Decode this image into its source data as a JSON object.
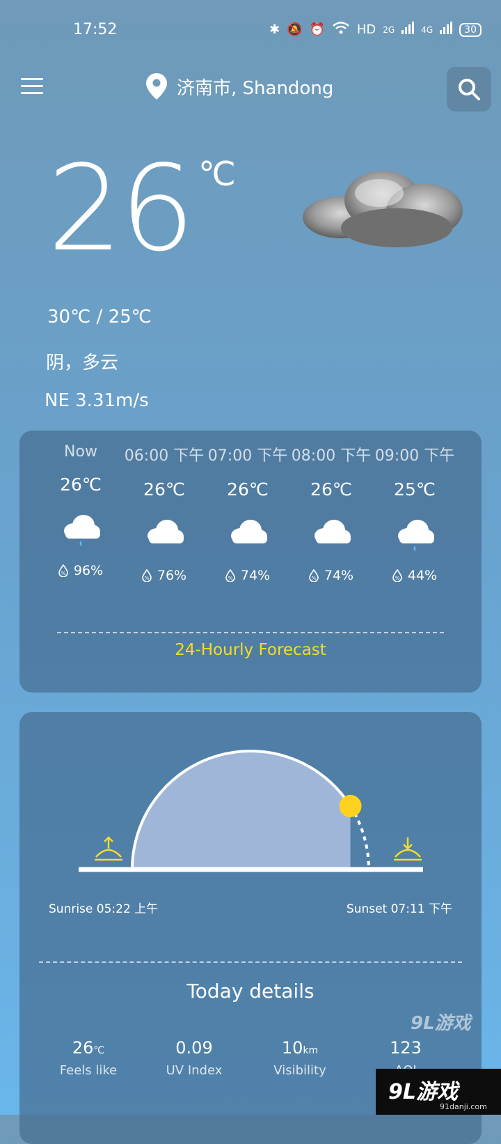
{
  "status_bar": {
    "time": "17:52",
    "network": "HD",
    "signal_2g": "2G",
    "signal_4g": "4G",
    "battery": "30"
  },
  "header": {
    "location": "济南市, Shandong"
  },
  "current": {
    "temperature": "26",
    "unit": "℃",
    "hi_lo": "30℃ / 25℃",
    "condition": "阴，多云",
    "wind": "NE  3.31m/s",
    "icon": "cloud-icon"
  },
  "hourly": [
    {
      "time": "Now",
      "temp": "26℃",
      "icon": "rain-cloud-icon",
      "humidity": "96%"
    },
    {
      "time": "06:00 下午",
      "temp": "26℃",
      "icon": "cloud-icon",
      "humidity": "76%"
    },
    {
      "time": "07:00 下午",
      "temp": "26℃",
      "icon": "cloud-icon",
      "humidity": "74%"
    },
    {
      "time": "08:00 下午",
      "temp": "26℃",
      "icon": "cloud-icon",
      "humidity": "74%"
    },
    {
      "time": "09:00 下午",
      "temp": "25℃",
      "icon": "rain-cloud-icon",
      "humidity": "44%"
    }
  ],
  "forecast_link": "24-Hourly Forecast",
  "sun": {
    "sunrise": "Sunrise 05:22 上午",
    "sunset": "Sunset 07:11 下午",
    "day_progress": 0.82
  },
  "details": {
    "title": "Today details",
    "items": [
      {
        "value": "26",
        "unit": "℃",
        "label": "Feels like"
      },
      {
        "value": "0.09",
        "unit": "",
        "label": "UV Index"
      },
      {
        "value": "10",
        "unit": "km",
        "label": "Visibility"
      },
      {
        "value": "123",
        "unit": "",
        "label": "AQI"
      }
    ]
  },
  "watermark": {
    "small": "9L游戏",
    "brand": "9L游戏",
    "url": "91danji.com"
  },
  "colors": {
    "accent_link": "#f5dc28",
    "sun": "#ffd21f",
    "arc_fill": "#9fb6d8"
  }
}
